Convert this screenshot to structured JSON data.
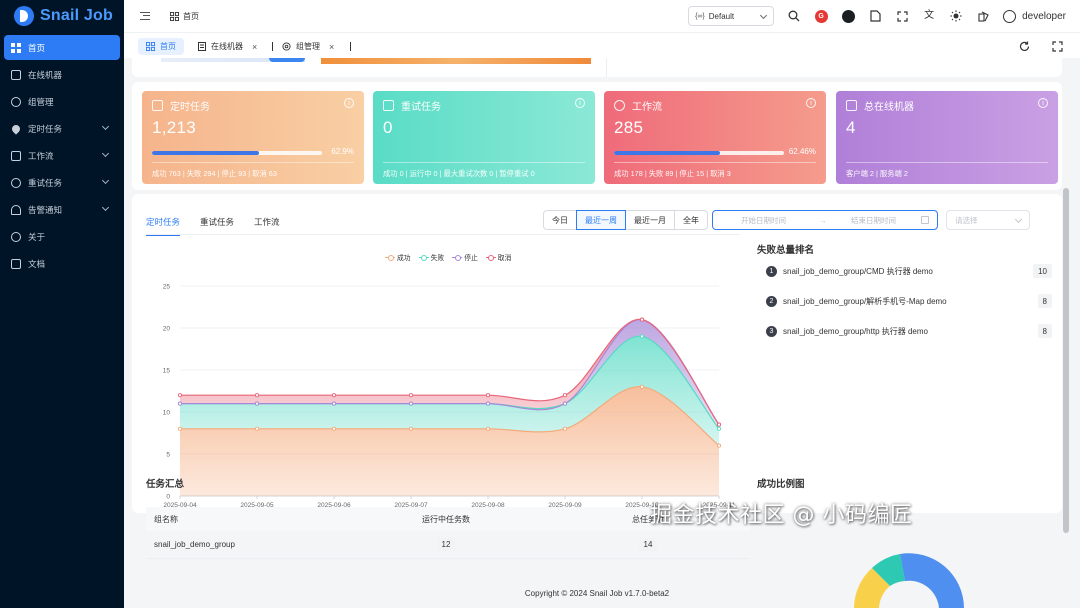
{
  "app": {
    "logo_text": "Snail Job"
  },
  "sidebar": {
    "items": [
      {
        "label": "首页",
        "icon": "dashboard-icon",
        "active": true
      },
      {
        "label": "在线机器",
        "icon": "document-icon"
      },
      {
        "label": "组管理",
        "icon": "settings-icon"
      },
      {
        "label": "定时任务",
        "icon": "flame-icon",
        "has_children": true
      },
      {
        "label": "工作流",
        "icon": "workflow-icon",
        "has_children": true
      },
      {
        "label": "重试任务",
        "icon": "retry-icon",
        "has_children": true
      },
      {
        "label": "告警通知",
        "icon": "bell-icon",
        "has_children": true
      },
      {
        "label": "关于",
        "icon": "info-icon"
      },
      {
        "label": "文档",
        "icon": "book-icon"
      }
    ]
  },
  "header": {
    "breadcrumb": "首页",
    "theme_select": "Default",
    "username": "developer",
    "gitee_badge": "G"
  },
  "tabs": [
    {
      "label": "首页",
      "active": true
    },
    {
      "label": "在线机器"
    },
    {
      "label": "组管理"
    }
  ],
  "cards": [
    {
      "title": "定时任务",
      "value": "1,213",
      "progress": 62.9,
      "progress_label": "62.9%",
      "footer": "成功 763 | 失败 294 | 停止 93 | 取消 63",
      "gradient": [
        "#f5b48c",
        "#f9cfa4"
      ]
    },
    {
      "title": "重试任务",
      "value": "0",
      "footer": "成功 0 | 运行中 0 | 最大重试次数 0 | 暂停重试 0",
      "gradient": [
        "#59dcc6",
        "#8be9d6"
      ]
    },
    {
      "title": "工作流",
      "value": "285",
      "progress": 62.46,
      "progress_label": "62.46%",
      "footer": "成功 178 | 失败 89 | 停止 15 | 取消 3",
      "gradient": [
        "#ef6b7a",
        "#f59c8c"
      ]
    },
    {
      "title": "总在线机器",
      "value": "4",
      "footer": "客户端 2 | 服务端 2",
      "gradient": [
        "#b07fd8",
        "#caa0e4"
      ]
    }
  ],
  "chart_panel": {
    "tabs": [
      "定时任务",
      "重试任务",
      "工作流"
    ],
    "range_buttons": [
      "今日",
      "最近一周",
      "最近一月",
      "全年"
    ],
    "active_range": "最近一周",
    "start_placeholder": "开始日期时间",
    "end_placeholder": "结束日期时间",
    "group_placeholder": "请选择"
  },
  "chart_data": {
    "type": "area",
    "x": [
      "2025-09-04",
      "2025-09-05",
      "2025-09-06",
      "2025-09-07",
      "2025-09-08",
      "2025-09-09",
      "2025-09-10",
      "2025-09-11"
    ],
    "ylim": [
      0,
      25
    ],
    "yticks": [
      0,
      5,
      10,
      15,
      20,
      25
    ],
    "stacked": true,
    "grid": true,
    "legend_position": "top-center",
    "series": [
      {
        "name": "成功",
        "color": "#f4a97a",
        "values": [
          8,
          8,
          8,
          8,
          8,
          8,
          13,
          6
        ]
      },
      {
        "name": "失败",
        "color": "#56dac4",
        "values": [
          3,
          3,
          3,
          3,
          3,
          3,
          6,
          2
        ]
      },
      {
        "name": "停止",
        "color": "#a889d8",
        "values": [
          0,
          0,
          0,
          0,
          0,
          0,
          2,
          0.5
        ]
      },
      {
        "name": "取消",
        "color": "#e8667a",
        "values": [
          1,
          1,
          1,
          1,
          1,
          1,
          0,
          0
        ]
      }
    ]
  },
  "fail_ranking": {
    "title": "失败总量排名",
    "items": [
      {
        "rank": "1",
        "name": "snail_job_demo_group/CMD 执行器 demo",
        "count": "10"
      },
      {
        "rank": "2",
        "name": "snail_job_demo_group/解析手机号-Map demo",
        "count": "8"
      },
      {
        "rank": "3",
        "name": "snail_job_demo_group/http 执行器 demo",
        "count": "8"
      }
    ]
  },
  "task_summary": {
    "title": "任务汇总",
    "columns": [
      "组名称",
      "运行中任务数",
      "总任务数"
    ],
    "rows": [
      {
        "group": "snail_job_demo_group",
        "running": "12",
        "total": "14"
      }
    ]
  },
  "success_ratio": {
    "title": "成功比例图"
  },
  "footer": {
    "copyright": "Copyright © 2024 Snail Job v1.7.0-beta2"
  },
  "watermark": "掘金技术社区 @ 小码编匠"
}
